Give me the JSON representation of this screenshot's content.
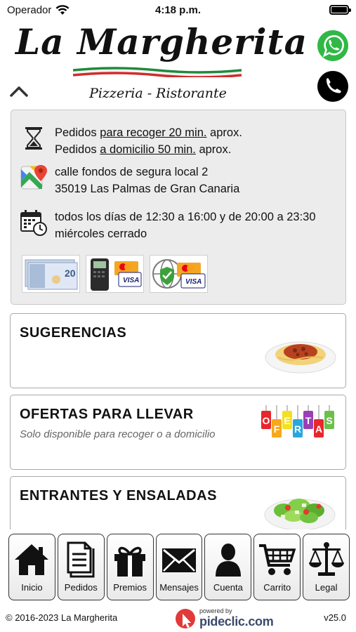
{
  "status_bar": {
    "carrier": "Operador",
    "time": "4:18 p.m."
  },
  "header": {
    "logo_title": "La Margherita",
    "logo_subtitle": "Pizzeria - Ristorante",
    "buttons": [
      "chevron-up-icon",
      "whatsapp-icon",
      "phone-icon"
    ]
  },
  "info": {
    "pickup": {
      "prefix": "Pedidos ",
      "link": "para recoger 20 min.",
      "suffix": " aprox."
    },
    "delivery": {
      "prefix": "Pedidos ",
      "link": "a domicilio 50 min.",
      "suffix": " aprox."
    },
    "address_line1": "calle fondos de segura local 2",
    "address_line2": "35019 Las Palmas de Gran Canaria",
    "hours": "todos los días de 12:30 a 16:00 y de 20:00 a 23:30 miércoles cerrado",
    "payment_icons": [
      "cash-icon",
      "card-terminal-icon",
      "secure-card-icon"
    ],
    "card_brand": "VISA",
    "banknote_value": "20"
  },
  "categories": [
    {
      "title": "SUGERENCIAS",
      "subtitle": "",
      "image": "spaghetti-icon"
    },
    {
      "title": "OFERTAS PARA LLEVAR",
      "subtitle": "Solo disponible para recoger o a domicilio",
      "image": "ofertas-tags-icon",
      "tag_letters": [
        "O",
        "F",
        "E",
        "R",
        "T",
        "A",
        "S"
      ]
    },
    {
      "title": "ENTRANTES Y ENSALADAS",
      "subtitle": "",
      "image": "salad-icon"
    }
  ],
  "tabbar": [
    {
      "label": "Inicio",
      "icon": "home-icon"
    },
    {
      "label": "Pedidos",
      "icon": "document-icon"
    },
    {
      "label": "Premios",
      "icon": "gift-icon"
    },
    {
      "label": "Mensajes",
      "icon": "envelope-icon"
    },
    {
      "label": "Cuenta",
      "icon": "user-icon"
    },
    {
      "label": "Carrito",
      "icon": "cart-icon"
    },
    {
      "label": "Legal",
      "icon": "scales-icon"
    }
  ],
  "footer": {
    "copyright": "© 2016-2023  La Margherita",
    "powered_small": "powered by",
    "powered_brand": "pideclic.com",
    "version": "v25.0"
  },
  "colors": {
    "whatsapp": "#2fb845",
    "flag_green": "#1f8a3a",
    "flag_red": "#d22a2a",
    "info_bg": "#ececec",
    "brand_blue": "#3a4a6b"
  }
}
